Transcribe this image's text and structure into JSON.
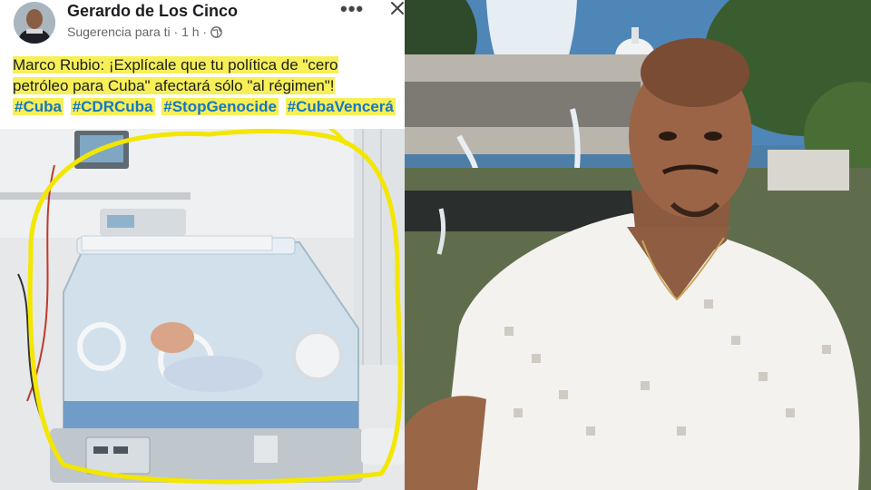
{
  "post": {
    "author": "Gerardo de Los Cinco",
    "meta": "Sugerencia para ti · 1 h ·",
    "text_lines": [
      "Marco Rubio: ¡Explícale que tu política de \"cero",
      "petróleo para Cuba\" afectará sólo \"al régimen\"!"
    ],
    "hashtags": [
      "#Cuba",
      "#CDRCuba",
      "#StopGenocide",
      "#CubaVencerá"
    ],
    "icons": {
      "avatar": "profile-avatar",
      "privacy": "globe-icon",
      "more": "more-options-icon",
      "close": "close-icon"
    },
    "colors": {
      "highlight": "#f6ef57",
      "hashtag": "#1877c2",
      "circle_annotation": "#f3e600"
    }
  },
  "right_photo": {
    "subject": "man-in-white-crochet-shirt",
    "background": "fountain-with-capitol-dome"
  }
}
